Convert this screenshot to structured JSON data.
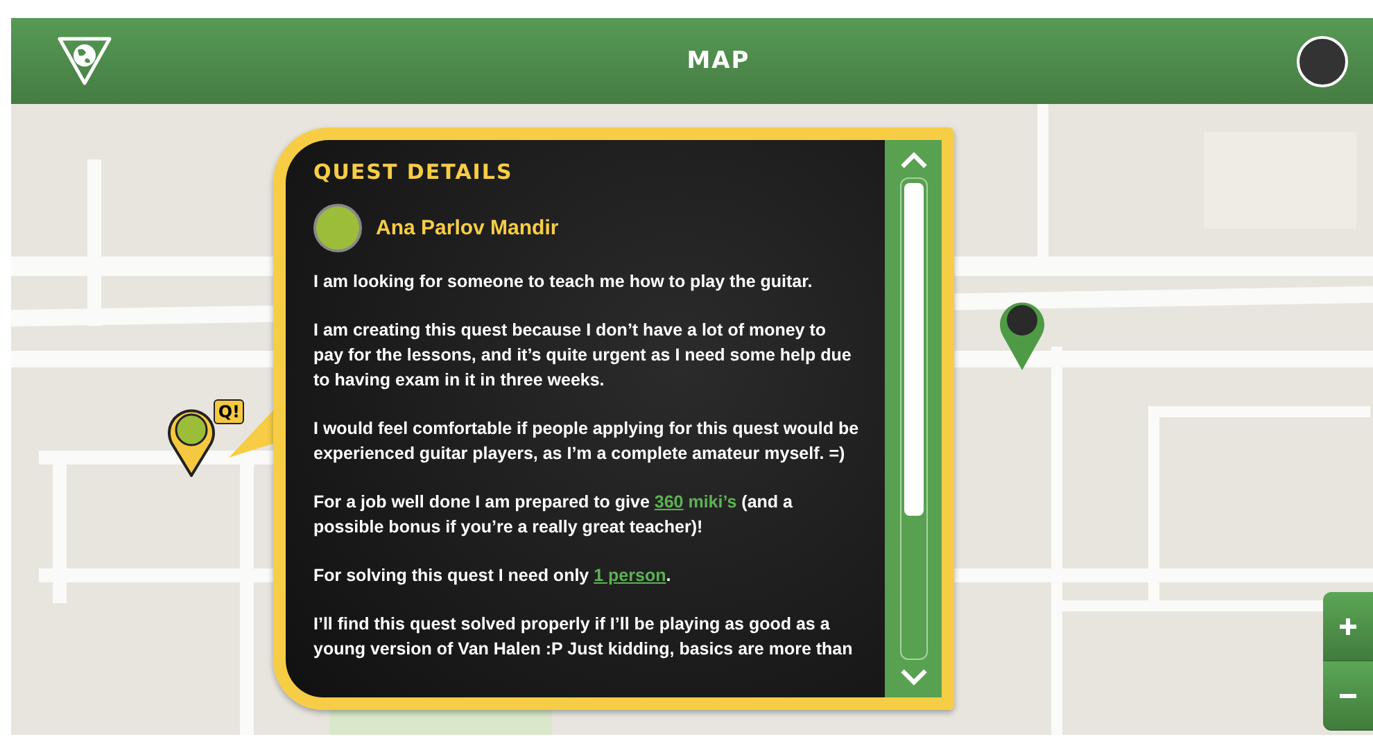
{
  "header": {
    "title": "MAP"
  },
  "map": {
    "quest_marker": {
      "badge": "Q!"
    }
  },
  "quest_details": {
    "title": "QUEST DETAILS",
    "author": "Ana Parlov Mandir",
    "paragraphs": [
      [
        {
          "kind": "text",
          "text": "I am looking for someone to teach me how to play the guitar."
        }
      ],
      [
        {
          "kind": "text",
          "text": "I am creating this quest because I don’t have a lot of money to pay for the lessons, and it’s quite urgent as I need some help due to having exam in it in three weeks."
        }
      ],
      [
        {
          "kind": "text",
          "text": "I would feel comfortable if people applying for this quest would be experienced guitar players, as I’m a complete amateur myself. =)"
        }
      ],
      [
        {
          "kind": "text",
          "text": "For a job well done I am prepared to give "
        },
        {
          "kind": "link",
          "text": "360"
        },
        {
          "kind": "highlight",
          "text": " miki’s"
        },
        {
          "kind": "text",
          "text": " (and a possible bonus if you’re a really great teacher)!"
        }
      ],
      [
        {
          "kind": "text",
          "text": "For solving this quest I need only "
        },
        {
          "kind": "link",
          "text": "1 person"
        },
        {
          "kind": "text",
          "text": "."
        }
      ],
      [
        {
          "kind": "text",
          "text": "I’ll find this quest solved properly if I’ll be playing as good as a young version of Van Halen :P Just kidding, basics are more than"
        }
      ]
    ]
  }
}
